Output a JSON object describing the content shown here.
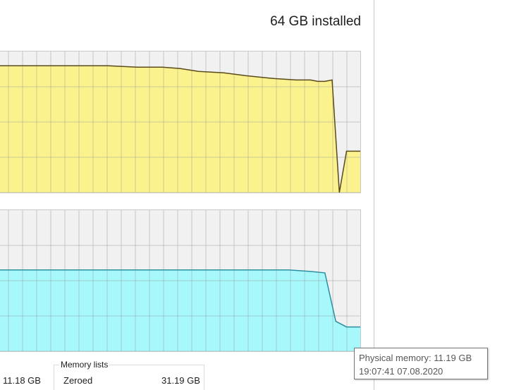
{
  "header": {
    "installed_label": "64 GB installed"
  },
  "graphs": {
    "usage": {
      "fill": "#fbf28e",
      "line": "#5a4a1a",
      "grid": "#c4bd86",
      "level": [
        0.9,
        0.9,
        0.9,
        0.89,
        0.89,
        0.89,
        0.88,
        0.86,
        0.85,
        0.83,
        0.82,
        0.81,
        0.8,
        0.8,
        0.79,
        0.79,
        0.8,
        0.01,
        0.3,
        0.3,
        0.3
      ],
      "level_times": [
        0,
        0.2,
        0.3,
        0.38,
        0.4,
        0.45,
        0.5,
        0.55,
        0.62,
        0.68,
        0.72,
        0.76,
        0.82,
        0.86,
        0.88,
        0.9,
        0.92,
        0.94,
        0.96,
        0.98,
        1.0
      ]
    },
    "composition": {
      "fill": "#a6f8fb",
      "line": "#2e8fa0",
      "grid": "#86c4c8",
      "level": [
        0.58,
        0.58,
        0.58,
        0.58,
        0.58,
        0.57,
        0.56,
        0.22,
        0.18,
        0.18,
        0.18
      ],
      "level_times": [
        0,
        0.2,
        0.4,
        0.6,
        0.8,
        0.86,
        0.9,
        0.93,
        0.96,
        0.98,
        1.0
      ]
    }
  },
  "stats": {
    "in_use_value": "11.18 GB"
  },
  "memory_lists": {
    "title": "Memory lists",
    "zeroed_label": "Zeroed",
    "zeroed_value": "31.19 GB"
  },
  "tooltip": {
    "line1": "Physical memory: 11.19 GB",
    "line2": "19:07:41 07.08.2020"
  }
}
